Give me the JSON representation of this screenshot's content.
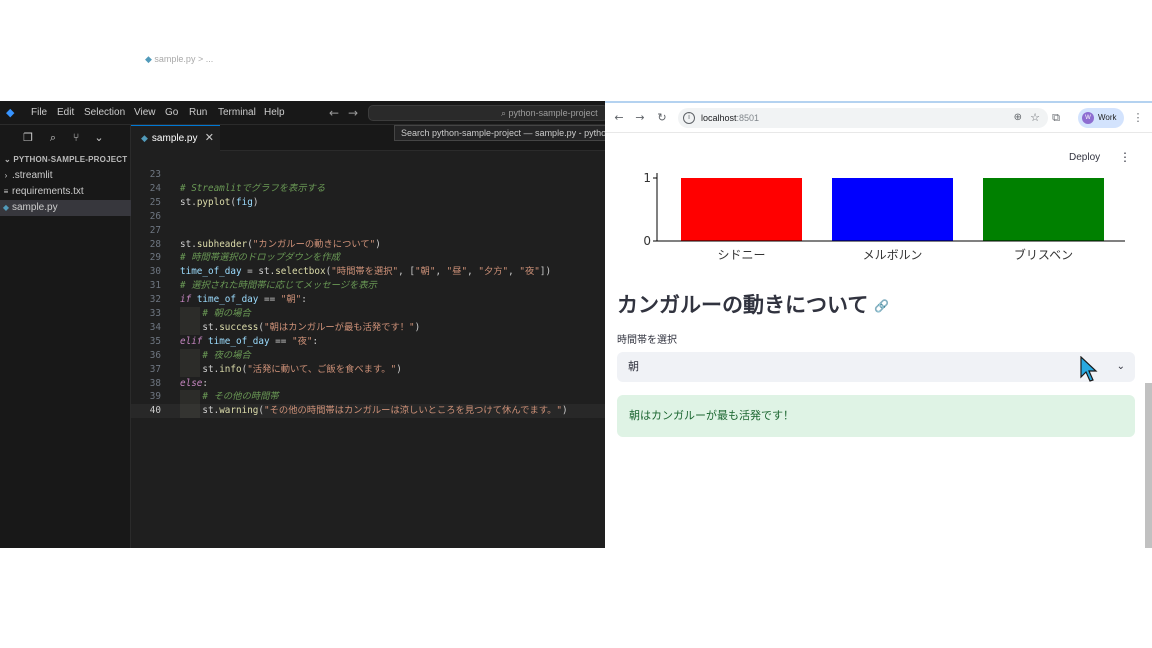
{
  "vscode": {
    "menu": [
      "File",
      "Edit",
      "Selection",
      "View",
      "Go",
      "Run",
      "Terminal",
      "Help"
    ],
    "search_text": "python-sample-project",
    "tooltip": "Search python-sample-project — sample.py - python-sample-project",
    "explorer": {
      "header": "PYTHON-SAMPLE-PROJECT",
      "items": [
        {
          "label": ".streamlit",
          "type": "folder"
        },
        {
          "label": "requirements.txt",
          "type": "file"
        },
        {
          "label": "sample.py",
          "type": "python",
          "active": true
        }
      ]
    },
    "tab": {
      "label": "sample.py",
      "close": "✕"
    },
    "breadcrumb": "sample.py > ...",
    "editor": {
      "current_line": 40,
      "lines": [
        {
          "n": "23",
          "code": ""
        },
        {
          "n": "24",
          "code": "# Streamlitでグラフを表示する"
        },
        {
          "n": "25",
          "code": "st.pyplot(fig)"
        },
        {
          "n": "26",
          "code": ""
        },
        {
          "n": "27",
          "code": ""
        },
        {
          "n": "28",
          "code": "st.subheader(\"カンガルーの動きについて\")"
        },
        {
          "n": "29",
          "code": "# 時間帯選択のドロップダウンを作成"
        },
        {
          "n": "30",
          "code": "time_of_day = st.selectbox(\"時間帯を選択\", [\"朝\", \"昼\", \"夕方\", \"夜\"])"
        },
        {
          "n": "31",
          "code": "# 選択された時間帯に応じてメッセージを表示"
        },
        {
          "n": "32",
          "code": "if time_of_day == \"朝\":"
        },
        {
          "n": "33",
          "code": "    # 朝の場合"
        },
        {
          "n": "34",
          "code": "    st.success(\"朝はカンガルーが最も活発です！\")"
        },
        {
          "n": "35",
          "code": "elif time_of_day == \"夜\":"
        },
        {
          "n": "36",
          "code": "    # 夜の場合"
        },
        {
          "n": "37",
          "code": "    st.info(\"活発に動いて、ご飯を食べます。\")"
        },
        {
          "n": "38",
          "code": "else:"
        },
        {
          "n": "39",
          "code": "    # その他の時間帯"
        },
        {
          "n": "40",
          "code": "    st.warning(\"その他の時間帯はカンガルーは涼しいところを見つけて休んでます。\")"
        }
      ]
    }
  },
  "browser": {
    "url_host": "localhost",
    "url_port": ":8501",
    "profile": "Work",
    "profile_initial": "W"
  },
  "streamlit": {
    "deploy": "Deploy",
    "subheader": "カンガルーの動きについて",
    "select_label": "時間帯を選択",
    "select_value": "朝",
    "success_message": "朝はカンガルーが最も活発です！"
  },
  "chart_data": {
    "type": "bar",
    "categories": [
      "シドニー",
      "メルボルン",
      "ブリスベン"
    ],
    "values": [
      1,
      1,
      1
    ],
    "colors": [
      "#ff0000",
      "#0000ff",
      "#008000"
    ],
    "yticks": [
      "0",
      "1"
    ],
    "ylim": [
      0,
      1
    ]
  },
  "colors": {
    "vscode_bg": "#1f1f1f",
    "accent": "#0078d4",
    "success_bg": "#dff3e5",
    "success_text": "#1b6630"
  }
}
